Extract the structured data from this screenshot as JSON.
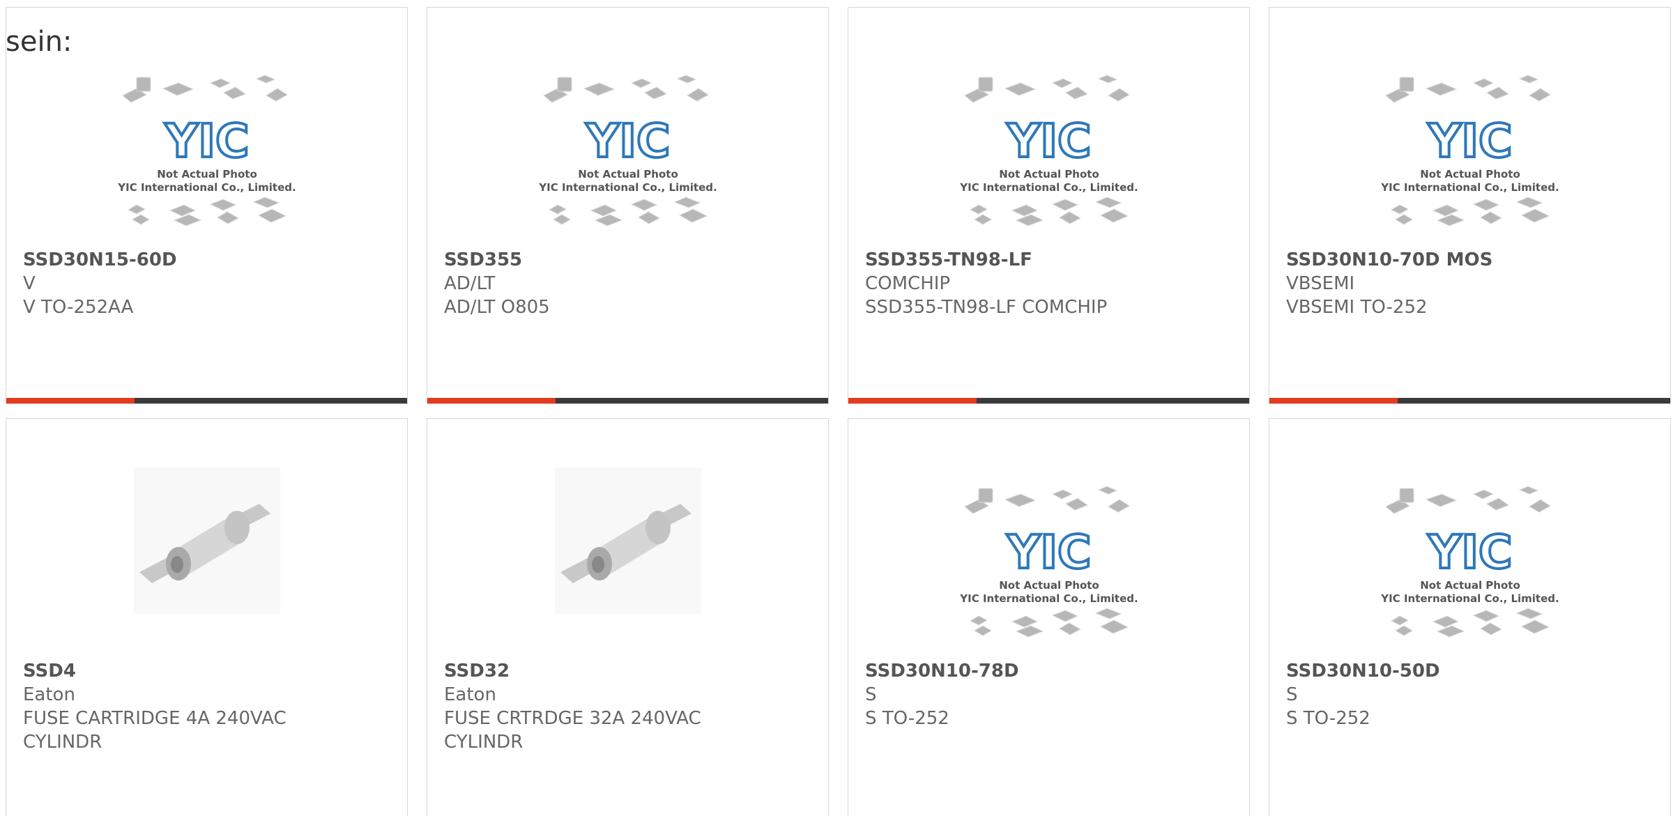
{
  "page": {
    "lead_text": "sein:"
  },
  "colors": {
    "accent": "#e63a1f",
    "bar_dark": "#3a3a3a",
    "logo_blue": "#2e78b9",
    "placeholder_gray": "#b7b7b7"
  },
  "placeholder_image": {
    "line1": "Not Actual Photo",
    "line2": "YIC International Co., Limited.",
    "logo_text": "YIC"
  },
  "products": [
    {
      "part_number": "SSD30N15-60D",
      "manufacturer": "V",
      "description": "V TO-252AA",
      "image": "placeholder"
    },
    {
      "part_number": "SSD355",
      "manufacturer": "AD/LT",
      "description": "AD/LT O805",
      "image": "placeholder"
    },
    {
      "part_number": "SSD355-TN98-LF",
      "manufacturer": "COMCHIP",
      "description": "SSD355-TN98-LF COMCHIP",
      "image": "placeholder"
    },
    {
      "part_number": "SSD30N10-70D MOS",
      "manufacturer": "VBSEMI",
      "description": "VBSEMI TO-252",
      "image": "placeholder"
    },
    {
      "part_number": "SSD4",
      "manufacturer": "Eaton",
      "description": "FUSE CARTRIDGE 4A 240VAC\nCYLINDR",
      "image": "fuse"
    },
    {
      "part_number": "SSD32",
      "manufacturer": "Eaton",
      "description": "FUSE CRTRDGE 32A 240VAC\nCYLINDR",
      "image": "fuse"
    },
    {
      "part_number": "SSD30N10-78D",
      "manufacturer": "S",
      "description": "S TO-252",
      "image": "placeholder"
    },
    {
      "part_number": "SSD30N10-50D",
      "manufacturer": "S",
      "description": "S TO-252",
      "image": "placeholder"
    }
  ]
}
